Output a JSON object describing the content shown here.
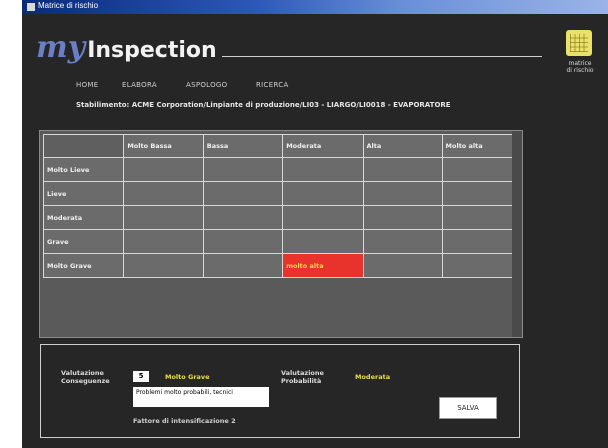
{
  "window": {
    "title": "Matrice di rischio"
  },
  "logo": {
    "prefix": "my",
    "name": "Inspection"
  },
  "matrix_icon": {
    "label_line1": "matrice",
    "label_line2": "di rischio",
    "color": "#e9e26a"
  },
  "nav": [
    "HOME",
    "ELABORA",
    "ASPOLOGO",
    "RICERCA"
  ],
  "breadcrumb": "Stabilimento: ACME Corporation/Linpiante di produzione/LI03 - LIARGO/LI0018 - EVAPORATORE",
  "matrix": {
    "columns": [
      "Molto Bassa",
      "Bassa",
      "Moderata",
      "Alta",
      "Molto alta"
    ],
    "rows": [
      "Molto Lieve",
      "Lieve",
      "Moderata",
      "Grave",
      "Molto Grave"
    ],
    "highlight": {
      "row": 4,
      "col": 2,
      "text": "molto alta",
      "color": "#e8332d"
    }
  },
  "form": {
    "consequences_label": "Valutazione Conseguenze",
    "consequences_value": "5",
    "consequences_text": "Molto Grave",
    "probability_label": "Valutazione Probabilità",
    "probability_text": "Moderata",
    "notes_value": "Problemi molto probabili, tecnici",
    "save_label": "SALVA",
    "factor_label": "Fattore di intensificazione 2"
  }
}
